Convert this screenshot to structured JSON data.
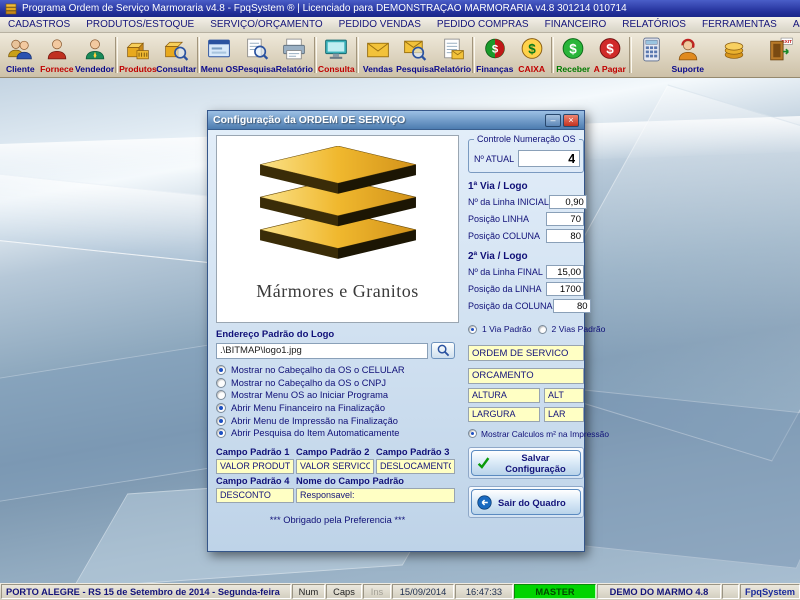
{
  "window": {
    "title": "Programa Ordem de Serviço Marmoraria v4.8 - FpqSystem ® | Licenciado para  DEMONSTRAÇÃO MARMORARIA v4.8 301214 010714"
  },
  "menu": {
    "items": [
      "CADASTROS",
      "PRODUTOS/ESTOQUE",
      "SERVIÇO/ORÇAMENTO",
      "PEDIDO VENDAS",
      "PEDIDO COMPRAS",
      "FINANCEIRO",
      "RELATÓRIOS",
      "FERRAMENTAS",
      "AJUDA"
    ]
  },
  "toolbar": {
    "buttons": [
      {
        "label": "Cliente",
        "color": "#0a0a8c"
      },
      {
        "label": "Fornece",
        "color": "#c00000"
      },
      {
        "label": "Vendedor",
        "color": "#0a0a8c"
      },
      {
        "label": "Produtos",
        "color": "#c00000"
      },
      {
        "label": "Consultar",
        "color": "#0a0a8c"
      },
      {
        "label": "Menu OS",
        "color": "#0a0a8c"
      },
      {
        "label": "Pesquisa",
        "color": "#0a0a8c"
      },
      {
        "label": "Relatório",
        "color": "#0a0a8c"
      },
      {
        "label": "Consulta",
        "color": "#c00000"
      },
      {
        "label": "Vendas",
        "color": "#0a0a8c"
      },
      {
        "label": "Pesquisa",
        "color": "#0a0a8c"
      },
      {
        "label": "Relatório",
        "color": "#0a0a8c"
      },
      {
        "label": "Finanças",
        "color": "#0a0a8c"
      },
      {
        "label": "CAIXA",
        "color": "#c00000"
      },
      {
        "label": "Receber",
        "color": "#007a00"
      },
      {
        "label": "A Pagar",
        "color": "#c00000"
      },
      {
        "label": "",
        "color": "#0a0a8c"
      },
      {
        "label": "Suporte",
        "color": "#0a0a8c"
      },
      {
        "label": "",
        "color": "#0a0a8c"
      },
      {
        "label": "",
        "color": "#0a0a8c"
      }
    ]
  },
  "dialog": {
    "title": "Configuração da ORDEM DE SERVIÇO",
    "logo_text": "Mármores e Granitos",
    "logo_path_label": "Endereço Padrão do Logo",
    "logo_path_value": ".\\BITMAP\\logo1.jpg",
    "options": [
      {
        "label": "Mostrar no Cabeçalho da OS o CELULAR",
        "checked": true
      },
      {
        "label": "Mostrar no Cabeçalho da OS o CNPJ",
        "checked": false
      },
      {
        "label": "Mostrar Menu OS ao Iniciar Programa",
        "checked": false
      },
      {
        "label": "Abrir Menu Financeiro na Finalização",
        "checked": true
      },
      {
        "label": "Abrir Menu de Impressão na Finalização",
        "checked": true
      },
      {
        "label": "Abrir Pesquisa do Item Automaticamente",
        "checked": true
      }
    ],
    "campos": {
      "campo1_label": "Campo Padrão 1",
      "campo1_value": "VALOR PRODUTOS",
      "campo2_label": "Campo Padrão 2",
      "campo2_value": "VALOR SERVICOS",
      "campo3_label": "Campo Padrão 3",
      "campo3_value": "DESLOCAMENTO",
      "campo4_label": "Campo Padrão 4",
      "campo4_value": "DESCONTO",
      "nome_label": "Nome do Campo Padrão",
      "nome_value": "Responsavel:"
    },
    "footer_note": "*** Obrigado pela Preferencia ***",
    "numeracao": {
      "group_label": "Controle Numeração OS",
      "atual_label": "Nº ATUAL",
      "atual_value": "4"
    },
    "via1": {
      "title": "1ª Via / Logo",
      "rows": [
        {
          "label": "Nº da Linha INICIAL",
          "value": "0,90"
        },
        {
          "label": "Posição LINHA",
          "value": "70"
        },
        {
          "label": "Posição COLUNA",
          "value": "80"
        }
      ]
    },
    "via2": {
      "title": "2ª Via / Logo",
      "rows": [
        {
          "label": "Nº da Linha FINAL",
          "value": "15,00"
        },
        {
          "label": "Posição da LINHA",
          "value": "1700"
        },
        {
          "label": "Posição da COLUNA",
          "value": "80"
        }
      ]
    },
    "via_radio": [
      {
        "label": "1 Via Padrão",
        "checked": true
      },
      {
        "label": "2 Vias Padrão",
        "checked": false
      }
    ],
    "doc_field1": "ORDEM DE SERVICO",
    "doc_field2": "ORCAMENTO",
    "dim": {
      "altura": "ALTURA",
      "alt": "ALT",
      "largura": "LARGURA",
      "lar": "LAR"
    },
    "calc_option": {
      "label": "Mostrar Calculos m² na Impressão",
      "checked": true
    },
    "buttons": {
      "save": "Salvar Configuração",
      "exit": "Sair do Quadro"
    }
  },
  "statusbar": {
    "location": "PORTO ALEGRE - RS 15 de Setembro de 2014 - Segunda-feira",
    "num": "Num",
    "caps": "Caps",
    "ins": "Ins",
    "date": "15/09/2014",
    "time": "16:47:33",
    "user": "MASTER",
    "db": "DEMO DO MARMO 4.8",
    "brand": "FpqSystem"
  }
}
